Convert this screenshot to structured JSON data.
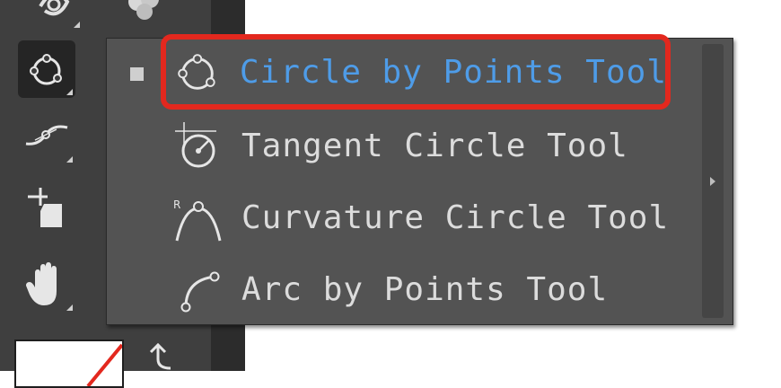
{
  "toolbar": {
    "tools": [
      {
        "name": "circle-by-points-tool-icon",
        "active": true
      },
      {
        "name": "curve-tool-icon"
      },
      {
        "name": "crop-tool-icon"
      },
      {
        "name": "hand-tool-icon"
      }
    ]
  },
  "flyout": {
    "items": [
      {
        "label": "Circle by Points Tool",
        "icon": "circle-by-points-icon",
        "selected": true
      },
      {
        "label": "Tangent Circle Tool",
        "icon": "tangent-circle-icon"
      },
      {
        "label": "Curvature Circle Tool",
        "icon": "curvature-circle-icon"
      },
      {
        "label": "Arc by Points Tool",
        "icon": "arc-by-points-icon"
      }
    ]
  },
  "colors": {
    "toolbar_bg": "#3f3f3f",
    "flyout_bg": "#535353",
    "selected_text": "#4e9ce8",
    "highlight_border": "#e3281e"
  }
}
